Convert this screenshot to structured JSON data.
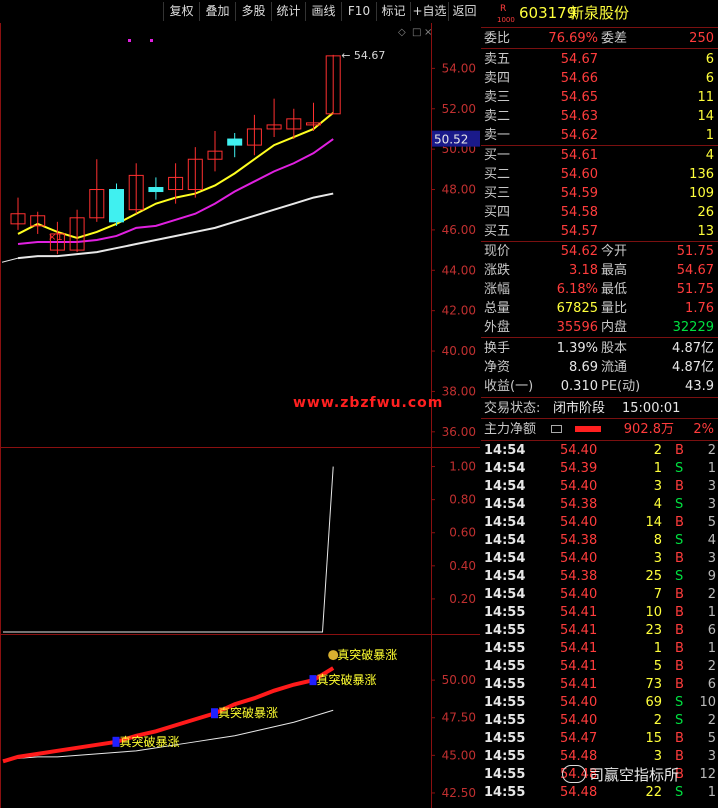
{
  "toolbar": {
    "buttons": [
      "复权",
      "叠加",
      "多股",
      "统计",
      "画线",
      "F10",
      "标记",
      "+自选",
      "返回"
    ],
    "icons": [
      "gear-icon",
      "diamond-icon",
      "square-icon",
      "close-icon"
    ]
  },
  "stock": {
    "r_label": "R",
    "sub_label": "1000",
    "code": "603179",
    "name": "新泉股份"
  },
  "quote": {
    "weibi_label": "委比",
    "weibi": "76.69%",
    "weicha_label": "委差",
    "weicha": "250",
    "asks": [
      {
        "label": "卖五",
        "price": "54.67",
        "vol": "6"
      },
      {
        "label": "卖四",
        "price": "54.66",
        "vol": "6"
      },
      {
        "label": "卖三",
        "price": "54.65",
        "vol": "11"
      },
      {
        "label": "卖二",
        "price": "54.63",
        "vol": "14"
      },
      {
        "label": "卖一",
        "price": "54.62",
        "vol": "1"
      }
    ],
    "bids": [
      {
        "label": "买一",
        "price": "54.61",
        "vol": "4"
      },
      {
        "label": "买二",
        "price": "54.60",
        "vol": "136"
      },
      {
        "label": "买三",
        "price": "54.59",
        "vol": "109"
      },
      {
        "label": "买四",
        "price": "54.58",
        "vol": "26"
      },
      {
        "label": "买五",
        "price": "54.57",
        "vol": "13"
      }
    ],
    "stats": [
      {
        "l1": "现价",
        "v1": "54.62",
        "c1": "red",
        "l2": "今开",
        "v2": "51.75",
        "c2": "red"
      },
      {
        "l1": "涨跌",
        "v1": "3.18",
        "c1": "red",
        "l2": "最高",
        "v2": "54.67",
        "c2": "red"
      },
      {
        "l1": "涨幅",
        "v1": "6.18%",
        "c1": "red",
        "l2": "最低",
        "v2": "51.75",
        "c2": "red"
      },
      {
        "l1": "总量",
        "v1": "67825",
        "c1": "yellow",
        "l2": "量比",
        "v2": "1.76",
        "c2": "red"
      },
      {
        "l1": "外盘",
        "v1": "35596",
        "c1": "red",
        "l2": "内盘",
        "v2": "32229",
        "c2": "green"
      }
    ],
    "fund": [
      {
        "l1": "换手",
        "v1": "1.39%",
        "l2": "股本",
        "v2": "4.87亿"
      },
      {
        "l1": "净资",
        "v1": "8.69",
        "l2": "流通",
        "v2": "4.87亿"
      },
      {
        "l1": "收益(一)",
        "v1": "0.310",
        "l2": "PE(动)",
        "v2": "43.9"
      }
    ],
    "status_label": "交易状态:",
    "status": "闭市阶段",
    "status_time": "15:00:01",
    "flow_label": "主力净额",
    "flow_value": "902.8万",
    "flow_pct": "2%"
  },
  "ticks": [
    {
      "t": "14:54",
      "p": "54.40",
      "v": "2",
      "d": "B",
      "n": "2"
    },
    {
      "t": "14:54",
      "p": "54.39",
      "v": "1",
      "d": "S",
      "n": "1"
    },
    {
      "t": "14:54",
      "p": "54.40",
      "v": "3",
      "d": "B",
      "n": "3"
    },
    {
      "t": "14:54",
      "p": "54.38",
      "v": "4",
      "d": "S",
      "n": "3"
    },
    {
      "t": "14:54",
      "p": "54.40",
      "v": "14",
      "d": "B",
      "n": "5"
    },
    {
      "t": "14:54",
      "p": "54.38",
      "v": "8",
      "d": "S",
      "n": "4"
    },
    {
      "t": "14:54",
      "p": "54.40",
      "v": "3",
      "d": "B",
      "n": "3"
    },
    {
      "t": "14:54",
      "p": "54.38",
      "v": "25",
      "d": "S",
      "n": "9"
    },
    {
      "t": "14:54",
      "p": "54.40",
      "v": "7",
      "d": "B",
      "n": "2"
    },
    {
      "t": "14:55",
      "p": "54.41",
      "v": "10",
      "d": "B",
      "n": "1"
    },
    {
      "t": "14:55",
      "p": "54.41",
      "v": "23",
      "d": "B",
      "n": "6"
    },
    {
      "t": "14:55",
      "p": "54.41",
      "v": "1",
      "d": "B",
      "n": "1"
    },
    {
      "t": "14:55",
      "p": "54.41",
      "v": "5",
      "d": "B",
      "n": "2"
    },
    {
      "t": "14:55",
      "p": "54.41",
      "v": "73",
      "d": "B",
      "n": "6"
    },
    {
      "t": "14:55",
      "p": "54.40",
      "v": "69",
      "d": "S",
      "n": "10"
    },
    {
      "t": "14:55",
      "p": "54.40",
      "v": "2",
      "d": "S",
      "n": "2"
    },
    {
      "t": "14:55",
      "p": "54.47",
      "v": "15",
      "d": "B",
      "n": "5"
    },
    {
      "t": "14:55",
      "p": "54.48",
      "v": "3",
      "d": "B",
      "n": "3"
    },
    {
      "t": "14:55",
      "p": "54.48",
      "v": "",
      "d": "B",
      "n": "12"
    },
    {
      "t": "14:55",
      "p": "54.48",
      "v": "22",
      "d": "S",
      "n": "1"
    }
  ],
  "watermark": "www.zbzfwu.com",
  "wechat": "司赢空指标所",
  "chart_data": [
    {
      "type": "candlestick",
      "ylim": [
        35,
        56
      ],
      "yticks": [
        "54.00",
        "52.00",
        "50.00",
        "48.00",
        "46.00",
        "44.00",
        "42.00",
        "40.00",
        "38.00",
        "36.00"
      ],
      "current_price_label": "50.52",
      "current_price": 50.52,
      "high_label": "54.67",
      "marker_label": "1",
      "candles": [
        {
          "o": 46.3,
          "c": 46.8,
          "h": 47.6,
          "l": 46.0
        },
        {
          "o": 46.2,
          "c": 46.7,
          "h": 46.9,
          "l": 45.8
        },
        {
          "o": 45.0,
          "c": 45.8,
          "h": 46.4,
          "l": 44.8
        },
        {
          "o": 45.0,
          "c": 46.6,
          "h": 47.0,
          "l": 44.9
        },
        {
          "o": 46.6,
          "c": 48.0,
          "h": 49.5,
          "l": 46.4
        },
        {
          "o": 48.0,
          "c": 46.4,
          "h": 48.3,
          "l": 46.2
        },
        {
          "o": 47.0,
          "c": 48.7,
          "h": 49.3,
          "l": 46.8
        },
        {
          "o": 48.1,
          "c": 47.9,
          "h": 48.6,
          "l": 47.5
        },
        {
          "o": 48.0,
          "c": 48.6,
          "h": 49.3,
          "l": 47.3
        },
        {
          "o": 48.0,
          "c": 49.5,
          "h": 50.1,
          "l": 47.6
        },
        {
          "o": 49.5,
          "c": 49.9,
          "h": 50.9,
          "l": 48.9
        },
        {
          "o": 50.5,
          "c": 50.2,
          "h": 50.8,
          "l": 49.6
        },
        {
          "o": 50.2,
          "c": 51.0,
          "h": 51.7,
          "l": 49.7
        },
        {
          "o": 51.0,
          "c": 51.2,
          "h": 52.5,
          "l": 50.6
        },
        {
          "o": 51.0,
          "c": 51.5,
          "h": 52.0,
          "l": 50.5
        },
        {
          "o": 51.2,
          "c": 51.3,
          "h": 52.3,
          "l": 50.9
        },
        {
          "o": 51.75,
          "c": 54.62,
          "h": 54.67,
          "l": 51.75
        }
      ],
      "ma_yellow": [
        45.8,
        46.3,
        45.9,
        45.6,
        45.9,
        46.3,
        46.8,
        47.3,
        47.6,
        47.8,
        48.2,
        48.8,
        49.5,
        50.2,
        50.6,
        51.0,
        51.8
      ],
      "ma_magenta": [
        45.3,
        45.4,
        45.4,
        45.4,
        45.5,
        45.7,
        46.1,
        46.2,
        46.5,
        46.8,
        47.3,
        47.9,
        48.4,
        48.9,
        49.3,
        49.8,
        50.5
      ],
      "ma_white": [
        44.6,
        44.7,
        44.7,
        44.8,
        44.9,
        45.1,
        45.3,
        45.5,
        45.7,
        45.9,
        46.1,
        46.4,
        46.7,
        47.0,
        47.3,
        47.6,
        47.8
      ]
    },
    {
      "type": "line",
      "ylim": [
        0,
        1.1
      ],
      "yticks": [
        "1.00",
        "0.80",
        "0.60",
        "0.40",
        "0.20"
      ],
      "values": [
        0,
        0,
        0,
        0,
        0,
        0,
        0,
        0,
        0,
        0,
        0,
        0,
        0,
        0,
        0,
        0,
        1.0
      ]
    },
    {
      "type": "line",
      "ylim": [
        41.5,
        53
      ],
      "yticks": [
        "50.00",
        "47.50",
        "45.00",
        "42.50",
        "40.00"
      ],
      "signal_label": "真突破暴涨",
      "red_values": [
        44.9,
        45.1,
        45.3,
        45.5,
        45.7,
        45.9,
        46.3,
        46.6,
        47.0,
        47.4,
        47.8,
        48.4,
        48.8,
        49.3,
        49.7,
        50.0,
        50.8
      ],
      "white_values": [
        44.8,
        44.9,
        44.9,
        45.0,
        45.1,
        45.2,
        45.3,
        45.5,
        45.7,
        45.9,
        46.1,
        46.3,
        46.6,
        46.9,
        47.2,
        47.6,
        48.0
      ],
      "signals": [
        5,
        10,
        15,
        16
      ]
    }
  ]
}
